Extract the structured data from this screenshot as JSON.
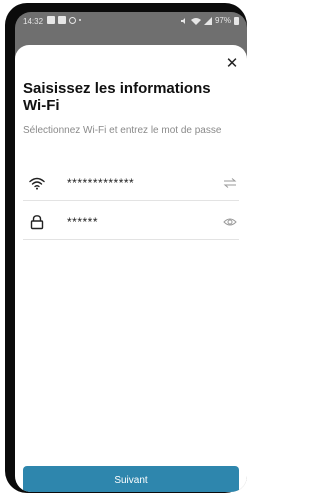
{
  "status_bar": {
    "time": "14:32",
    "battery": "97%",
    "left_icons": [
      "photo-icon",
      "mail-icon",
      "alarm-icon",
      "dot-icon"
    ],
    "right_icons": [
      "mute-icon",
      "wifi-signal-icon",
      "cell-signal-icon",
      "battery-icon"
    ]
  },
  "dialog": {
    "close_icon": "close-icon",
    "title": "Saisissez les informations Wi-Fi",
    "subtitle": "Sélectionnez Wi-Fi et entrez le mot de passe",
    "wifi_field": {
      "icon": "wifi-icon",
      "value": "*************",
      "trailing_icon": "swap-icon"
    },
    "password_field": {
      "icon": "lock-icon",
      "value": "******",
      "trailing_icon": "eye-icon"
    },
    "next_label": "Suivant",
    "accent_color": "#2e86ad"
  }
}
